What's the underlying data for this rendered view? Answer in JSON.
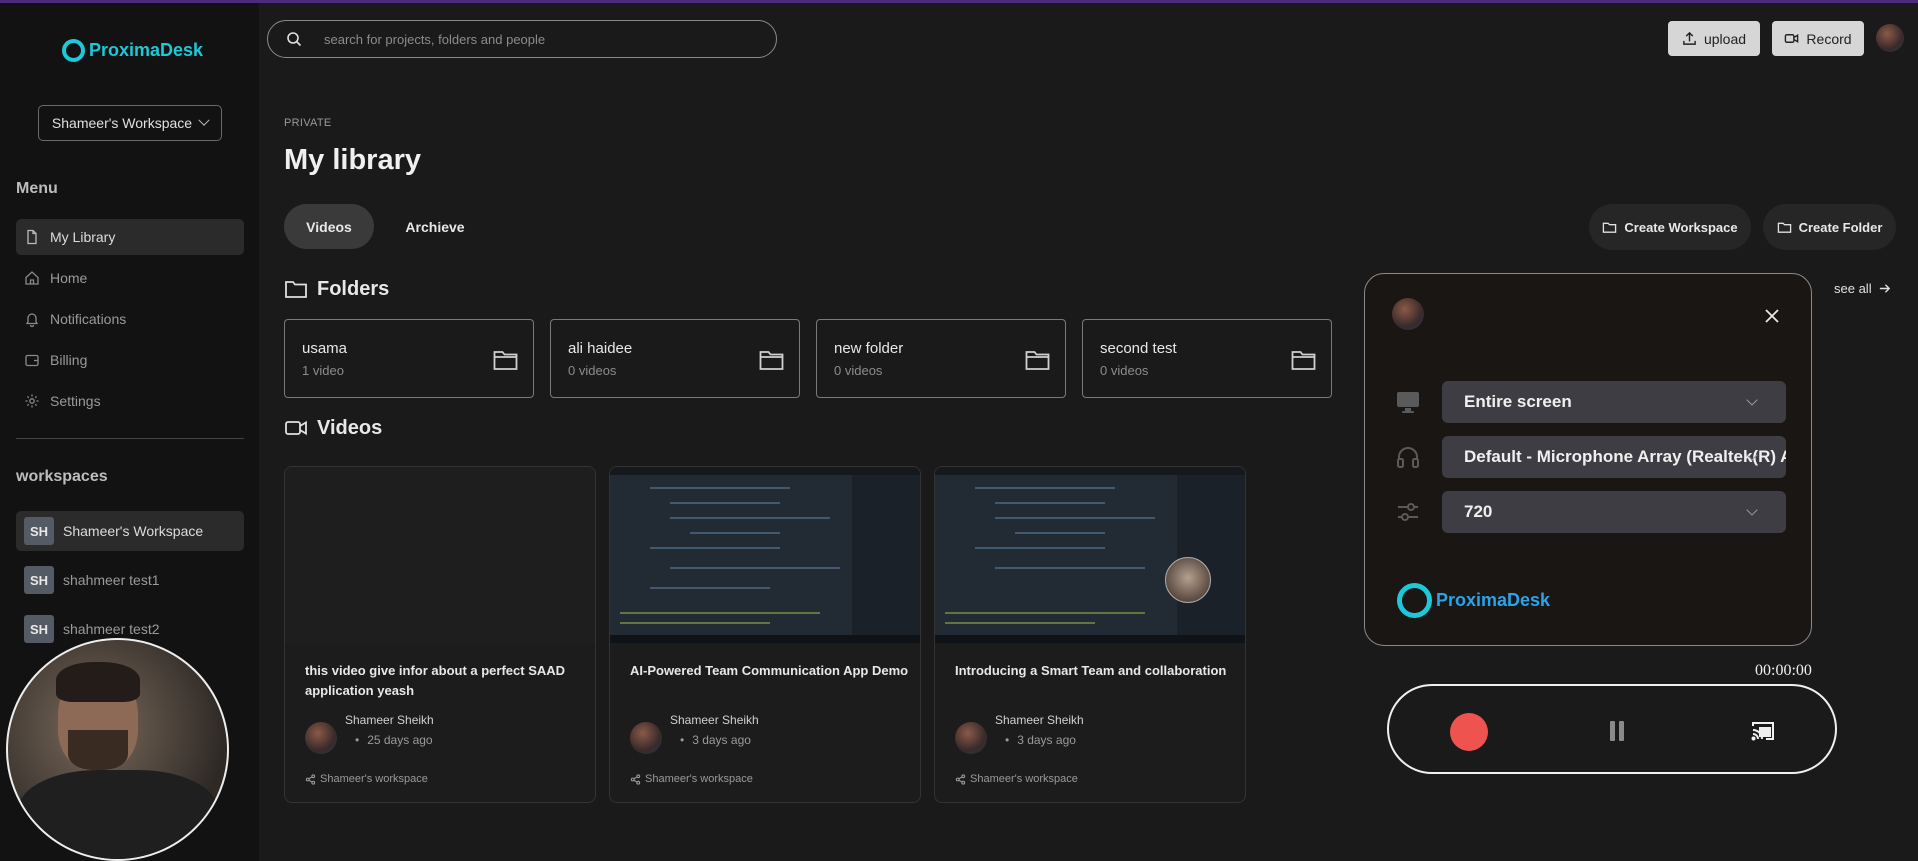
{
  "app": {
    "name": "ProximaDesk"
  },
  "sidebar": {
    "workspace_select": "Shameer's Workspace",
    "menu_heading": "Menu",
    "menu": [
      {
        "label": "My Library",
        "icon": "file-icon",
        "active": true
      },
      {
        "label": "Home",
        "icon": "home-icon",
        "active": false
      },
      {
        "label": "Notifications",
        "icon": "bell-icon",
        "active": false
      },
      {
        "label": "Billing",
        "icon": "wallet-icon",
        "active": false
      },
      {
        "label": "Settings",
        "icon": "gear-icon",
        "active": false
      }
    ],
    "workspaces_heading": "workspaces",
    "workspaces": [
      {
        "badge": "SH",
        "label": "Shameer's Workspace",
        "active": true
      },
      {
        "badge": "SH",
        "label": "shahmeer test1",
        "active": false
      },
      {
        "badge": "SH",
        "label": "shahmeer test2",
        "active": false
      }
    ]
  },
  "header": {
    "search_placeholder": "search for projects, folders and people",
    "upload_label": "upload",
    "record_label": "Record"
  },
  "main": {
    "eyebrow": "PRIVATE",
    "title": "My library",
    "tabs": [
      {
        "label": "Videos",
        "active": true
      },
      {
        "label": "Archieve",
        "active": false
      }
    ],
    "create_workspace": "Create Workspace",
    "create_folder": "Create Folder",
    "folders_heading": "Folders",
    "see_all": "see all",
    "folders": [
      {
        "name": "usama",
        "count": "1 video"
      },
      {
        "name": "ali haidee",
        "count": "0 videos"
      },
      {
        "name": "new folder",
        "count": "0 videos"
      },
      {
        "name": "second test",
        "count": "0 videos"
      }
    ],
    "videos_heading": "Videos",
    "videos": [
      {
        "title": "this video give infor about a perfect SAAD application yeash",
        "author": "Shameer Sheikh",
        "date": "25 days ago",
        "workspace": "Shameer's workspace",
        "thumb": "blank"
      },
      {
        "title": "AI-Powered Team Communication App Demo",
        "author": "Shameer Sheikh",
        "date": "3 days ago",
        "workspace": "Shameer's workspace",
        "thumb": "code"
      },
      {
        "title": "Introducing a Smart Team and collaboration",
        "author": "Shameer Sheikh",
        "date": "3 days ago",
        "workspace": "Shameer's workspace",
        "thumb": "code-cam"
      }
    ]
  },
  "recorder": {
    "screen": "Entire screen",
    "audio": "Default - Microphone Array (Realtek(R) Audio)",
    "quality": "720",
    "logo_text": "ProximaDesk",
    "timer": "00:00:00"
  },
  "colors": {
    "accent": "#1ec8d8",
    "record": "#ef5350",
    "brand_blue": "#2aa3ea"
  }
}
